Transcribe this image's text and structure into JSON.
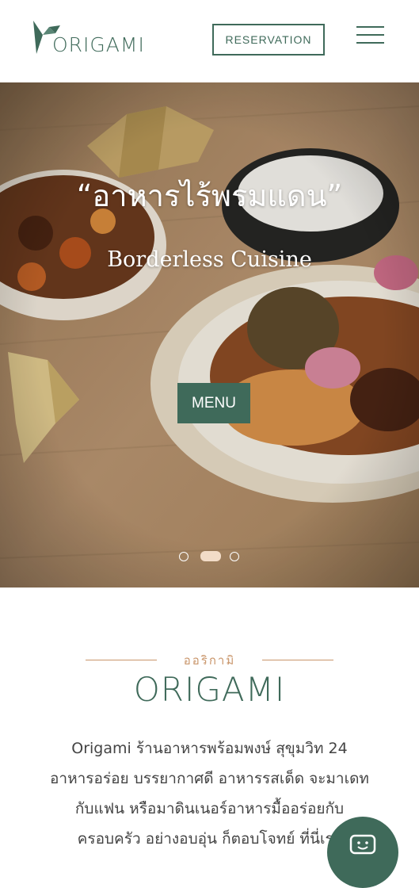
{
  "header": {
    "logo_text": "ORIGAMI",
    "reservation_label": "RESERVATION"
  },
  "hero": {
    "title": "“อาหารไร้พรมแดน”",
    "subtitle": "Borderless Cuisine",
    "menu_label": "MENU",
    "carousel": {
      "slides": 3,
      "active_index": 1
    }
  },
  "about": {
    "kicker": "ออริกามิ",
    "title": "ORIGAMI",
    "body_lines": [
      "Origami ร้านอาหารพร้อมพงษ์ สุขุมวิท 24",
      "อาหารอร่อย บรรยากาศดี อาหารรสเด็ด จะมาเดท",
      "กับแฟน หรือมาดินเนอร์อาหารมื้ออร่อยกับ",
      "ครอบครัว อย่างอบอุ่น ก็ตอบโจทย์ ที่นี่เรา"
    ]
  },
  "colors": {
    "brand_green": "#3f6a5a",
    "accent_copper": "#c9956a"
  },
  "icons": {
    "menu": "hamburger-icon",
    "chat": "chat-smile-icon",
    "logo": "origami-bird-icon"
  }
}
